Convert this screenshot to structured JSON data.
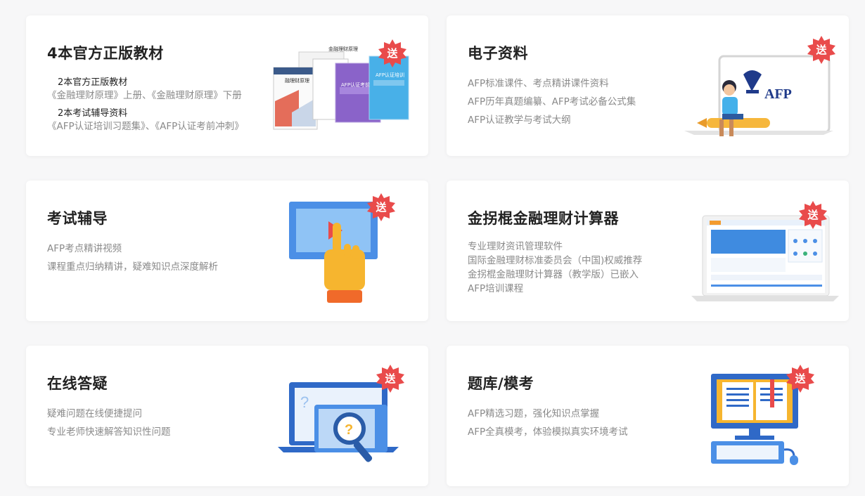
{
  "badge_label": "送",
  "colors": {
    "badge": "#e94b4b",
    "accent_blue": "#4b8fe6",
    "title": "#222222",
    "muted": "#8a8a8a"
  },
  "cards": [
    {
      "title": "4本官方正版教材",
      "items": [
        {
          "heading": "2本官方正版教材",
          "text": "《金融理财原理》上册、《金融理财原理》下册"
        },
        {
          "heading": "2本考试辅导资料",
          "text": "《AFP认证培训习题集》、《AFP认证考前冲刺》"
        }
      ],
      "books": [
        "金融理财原理",
        "融理财原理",
        "AFP认证考前冲刺",
        "AFP认证培训习题集"
      ],
      "icon": "books-icon"
    },
    {
      "title": "电子资料",
      "lines": [
        "AFP标准课件、考点精讲课件资料",
        "AFP历年真题编纂、AFP考试必备公式集",
        "AFP认证教学与考试大纲"
      ],
      "logo": "AFP",
      "icon": "laptop-afp-icon"
    },
    {
      "title": "考试辅导",
      "lines": [
        "AFP考点精讲视频",
        "课程重点归纳精讲，疑难知识点深度解析"
      ],
      "icon": "video-touch-icon"
    },
    {
      "title": "金拐棍金融理财计算器",
      "lines": [
        "专业理财资讯管理软件",
        "国际金融理财标准委员会（中国)权威推荐",
        "金拐棍金融理财计算器（教学版）已嵌入",
        "AFP培训课程"
      ],
      "icon": "calculator-software-icon"
    },
    {
      "title": "在线答疑",
      "lines": [
        "疑难问题在线便捷提问",
        "专业老师快速解答知识性问题"
      ],
      "icon": "question-laptop-icon"
    },
    {
      "title": "题库/模考",
      "lines": [
        "AFP精选习题，强化知识点掌握",
        "AFP全真模考，体验模拟真实环境考试"
      ],
      "icon": "computer-book-icon"
    }
  ]
}
